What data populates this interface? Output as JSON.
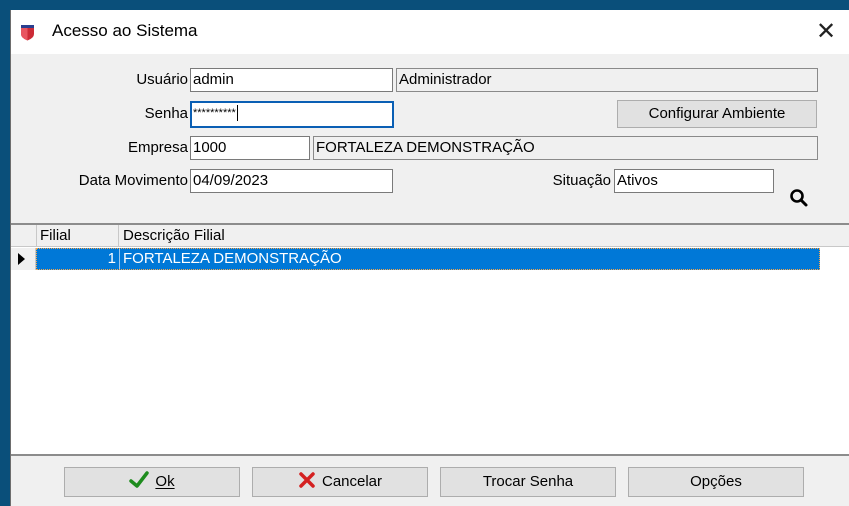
{
  "window": {
    "title": "Acesso ao Sistema",
    "close_glyph": "✕"
  },
  "form": {
    "usuario": {
      "label": "Usuário",
      "value": "admin",
      "name_value": "Administrador"
    },
    "senha": {
      "label": "Senha",
      "value": "**********"
    },
    "configurar_label": "Configurar Ambiente",
    "empresa": {
      "label": "Empresa",
      "code": "1000",
      "name": "FORTALEZA DEMONSTRAÇÃO"
    },
    "data_movimento": {
      "label": "Data Movimento",
      "value": "04/09/2023"
    },
    "situacao": {
      "label": "Situação",
      "value": "Ativos"
    }
  },
  "grid": {
    "columns": [
      "Filial",
      "Descrição Filial"
    ],
    "rows": [
      {
        "filial": "1",
        "descricao": "FORTALEZA DEMONSTRAÇÃO",
        "selected": true
      }
    ]
  },
  "footer": {
    "ok_label": "Ok",
    "cancelar_label": "Cancelar",
    "trocar_senha_label": "Trocar Senha",
    "opcoes_label": "Opções"
  },
  "colors": {
    "selection": "#0078d7",
    "focus_border": "#0a5fb4",
    "ok_icon": "#1e8c1e",
    "cancel_icon": "#d42020",
    "app_icon": "#cc2b36"
  },
  "icons": [
    "app-shield-icon",
    "close-icon",
    "search-icon",
    "row-pointer-icon",
    "check-icon",
    "x-icon"
  ]
}
